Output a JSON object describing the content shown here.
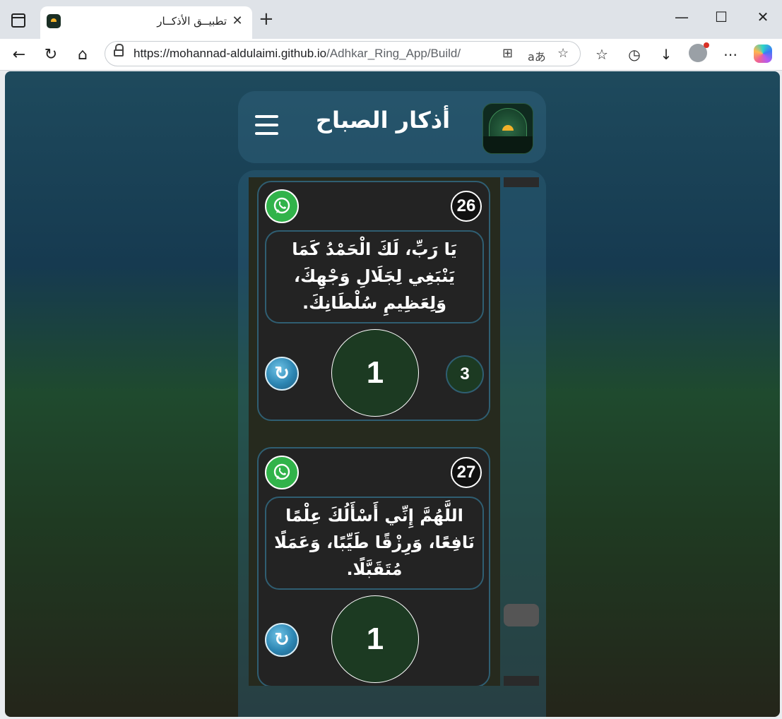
{
  "browser": {
    "tab_title": "تطبيــق الأذكــار",
    "url_main": "https://mohannad-aldulaimi.github.io",
    "url_path": "/Adhkar_Ring_App/Build/"
  },
  "header": {
    "title": "أذكار الصباح"
  },
  "cards": [
    {
      "number": "26",
      "text": "يَا رَبِّ، لَكَ الْحَمْدُ كَمَا يَنْبَغِي لِجَلَالِ وَجْهِكَ، وَلِعَظِيمِ سُلْطَانِكَ.",
      "count": "1",
      "target": "3"
    },
    {
      "number": "27",
      "text": "اللَّهُمَّ إِنِّي أَسْأَلُكَ عِلْمًا نَافِعًا، وَرِزْقًا طَيِّبًا، وَعَمَلًا مُتَقَبَّلًا.",
      "count": "1"
    }
  ],
  "colors": {
    "card_border": "#2f5e72",
    "counter_fill": "#1c3a22",
    "whatsapp_green": "#31b34a"
  },
  "icons": {
    "whatsapp": "whatsapp-icon",
    "reset": "refresh-icon",
    "menu": "hamburger-menu-icon"
  }
}
